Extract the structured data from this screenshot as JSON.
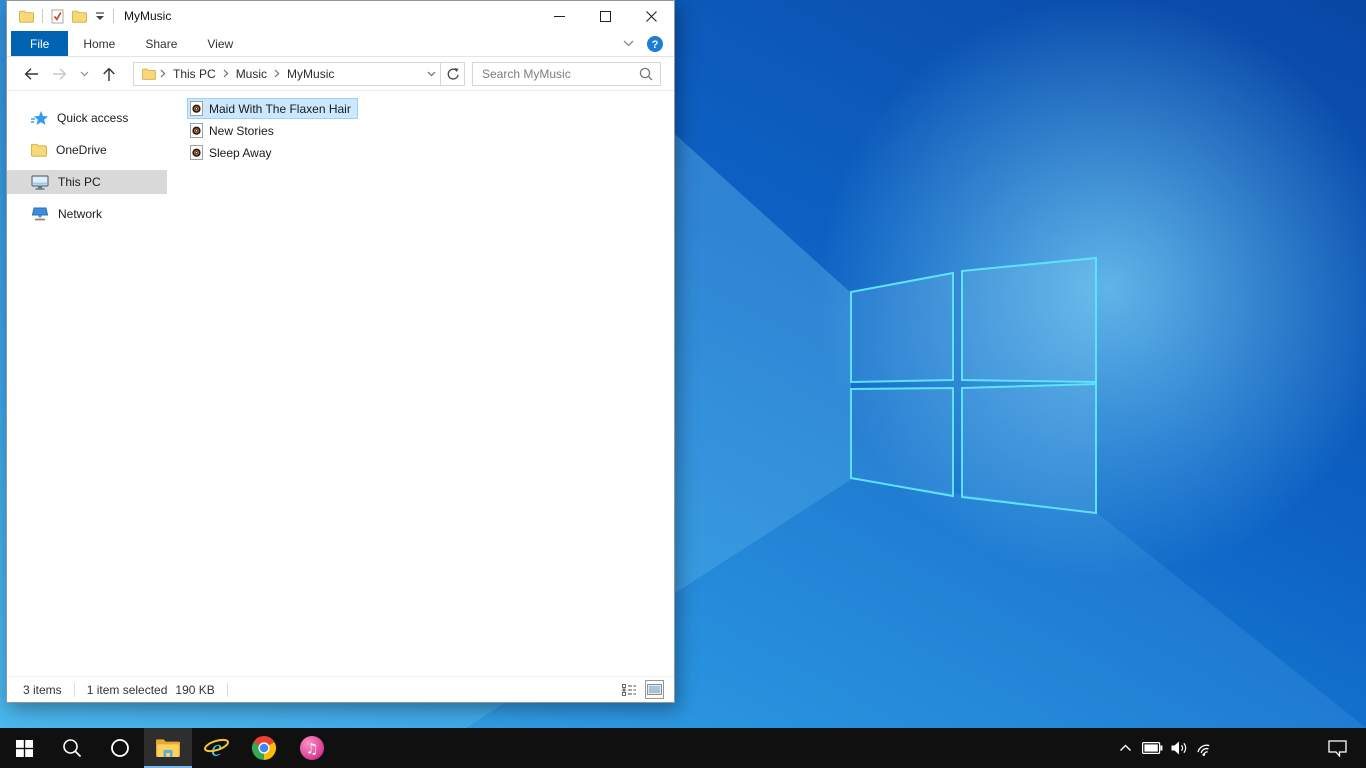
{
  "window": {
    "title": "MyMusic",
    "quick_access_toolbar": {
      "icons": [
        "folder-icon",
        "properties-icon",
        "new-folder-icon",
        "customize-quick-access-chevron-icon"
      ]
    },
    "caption_buttons": [
      "minimize",
      "maximize",
      "close"
    ],
    "tabs": [
      {
        "label": "File",
        "active": true
      },
      {
        "label": "Home",
        "active": false
      },
      {
        "label": "Share",
        "active": false
      },
      {
        "label": "View",
        "active": false
      }
    ],
    "ribbon": {
      "icons": [
        "expand-ribbon-chevron-icon",
        "help-icon"
      ]
    },
    "navigation_buttons": [
      "back",
      "forward",
      "recent-locations",
      "up"
    ],
    "address_bar": {
      "crumbs": [
        "This PC",
        "Music",
        "MyMusic"
      ],
      "icons": [
        "folder-icon",
        "chevron-down-icon",
        "refresh-icon"
      ]
    },
    "search": {
      "placeholder": "Search MyMusic",
      "value": "",
      "icon": "search-icon"
    },
    "nav_pane": {
      "items": [
        {
          "label": "Quick access",
          "icon": "quick-access-star-icon",
          "selected": false
        },
        {
          "label": "OneDrive",
          "icon": "folder-icon",
          "selected": false
        },
        {
          "label": "This PC",
          "icon": "monitor-icon",
          "selected": true
        },
        {
          "label": "Network",
          "icon": "network-icon",
          "selected": false
        }
      ]
    },
    "files": [
      {
        "name": "Maid With The Flaxen Hair",
        "icon": "audio-file-icon",
        "selected": true
      },
      {
        "name": "New Stories",
        "icon": "audio-file-icon",
        "selected": false
      },
      {
        "name": "Sleep Away",
        "icon": "audio-file-icon",
        "selected": false
      }
    ],
    "status_bar": {
      "item_count": "3 items",
      "selection": "1 item selected",
      "selection_size": "190 KB",
      "view_buttons": [
        "details-view",
        "thumbnails-view"
      ],
      "active_view": "thumbnails-view"
    }
  },
  "taskbar": {
    "buttons": [
      {
        "icon": "start-icon",
        "active": false
      },
      {
        "icon": "search-icon",
        "active": false
      },
      {
        "icon": "cortana-icon",
        "active": false
      },
      {
        "icon": "file-explorer-icon",
        "active": true
      },
      {
        "icon": "internet-explorer-icon",
        "active": false
      },
      {
        "icon": "chrome-icon",
        "active": false
      },
      {
        "icon": "itunes-icon",
        "active": false
      }
    ],
    "tray": {
      "icons": [
        "tray-expand-chevron-icon",
        "battery-icon",
        "volume-icon",
        "wifi-icon"
      ],
      "action_center_icon": "action-center-icon"
    }
  },
  "colors": {
    "accent_blue": "#0063b1",
    "file_selection_bg": "#cce8ff",
    "file_selection_border": "#99d1ff",
    "nav_selected_bg": "#d9d9d9",
    "taskbar_bg": "#101010",
    "taskbar_active_underline": "#76b9ed",
    "wallpaper_light": "#31a7e6",
    "wallpaper_dark": "#0a47a5",
    "logo_stroke": "#5ce3fd"
  }
}
